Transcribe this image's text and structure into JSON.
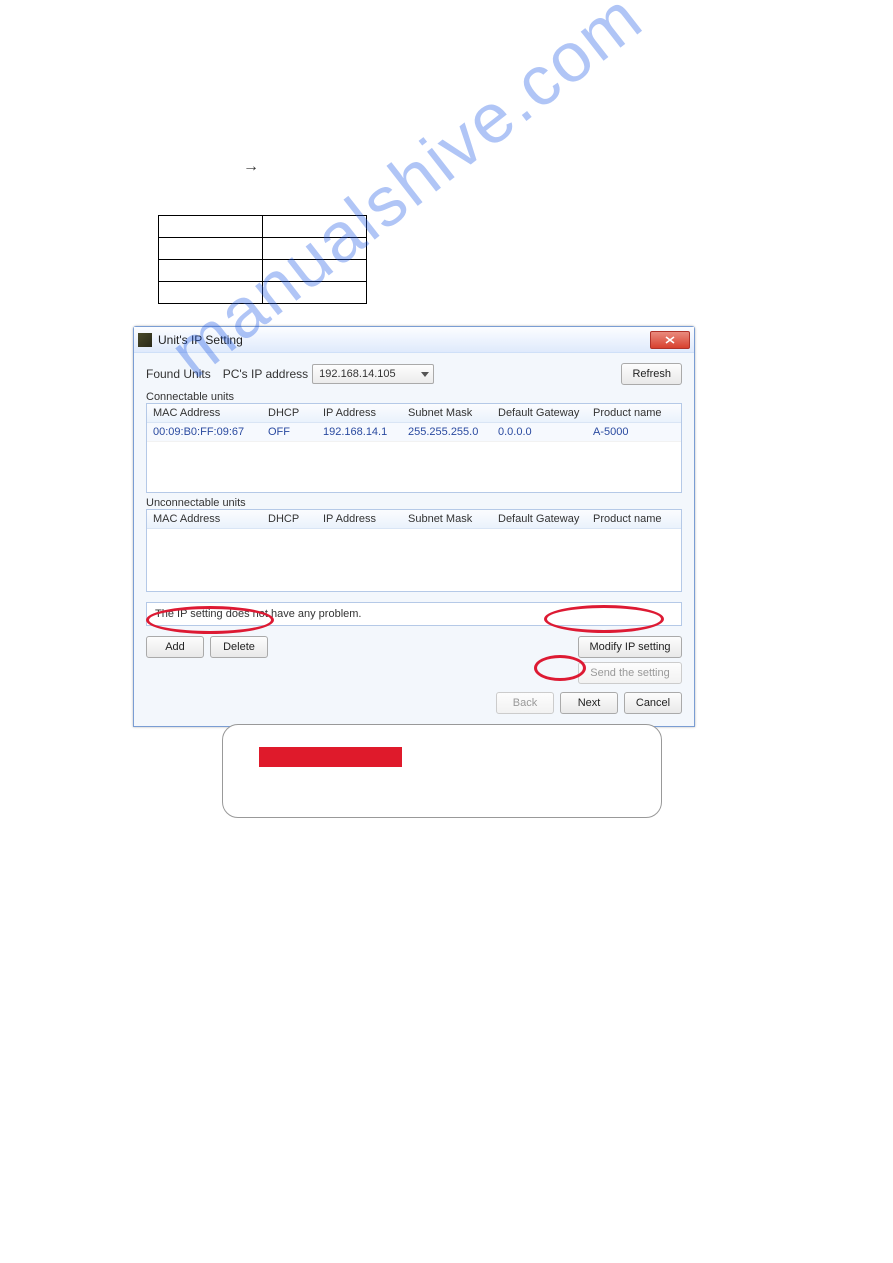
{
  "arrow": "→",
  "dialog": {
    "title": "Unit's IP Setting",
    "found_label": "Found Units",
    "pc_ip_label": "PC's IP address",
    "pc_ip_value": "192.168.14.105",
    "refresh": "Refresh",
    "connectable_label": "Connectable units",
    "unconnectable_label": "Unconnectable units",
    "columns": {
      "mac": "MAC Address",
      "dhcp": "DHCP",
      "ip": "IP Address",
      "mask": "Subnet Mask",
      "gw": "Default Gateway",
      "prod": "Product name"
    },
    "row": {
      "mac": "00:09:B0:FF:09:67",
      "dhcp": "OFF",
      "ip": "192.168.14.1",
      "mask": "255.255.255.0",
      "gw": "0.0.0.0",
      "prod": "A-5000"
    },
    "message": "The IP setting does not have any problem.",
    "add": "Add",
    "delete": "Delete",
    "modify": "Modify IP setting",
    "send": "Send the setting",
    "back": "Back",
    "next": "Next",
    "cancel": "Cancel"
  }
}
